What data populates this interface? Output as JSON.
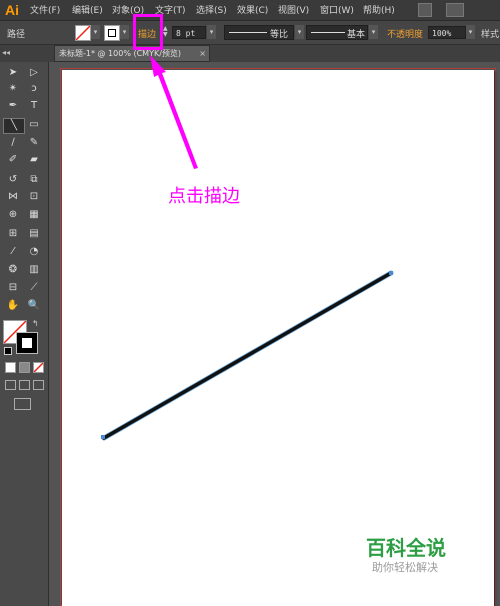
{
  "app": {
    "logo": "Ai"
  },
  "menus": [
    "文件(F)",
    "编辑(E)",
    "对象(O)",
    "文字(T)",
    "选择(S)",
    "效果(C)",
    "视图(V)",
    "窗口(W)",
    "帮助(H)"
  ],
  "control_bar": {
    "path_label": "路径",
    "stroke_label": "描边",
    "stroke_weight": "8 pt",
    "profile_label": "等比",
    "brush_label": "基本",
    "opacity_label": "不透明度",
    "opacity_value": "100%",
    "style_label": "样式"
  },
  "document_tab": {
    "title": "未标题-1* @ 100% (CMYK/预览)"
  },
  "annotation": {
    "text": "点击描边",
    "color": "#ff00ff"
  },
  "watermark": {
    "title": "百科全说",
    "subtitle": "助你轻松解决"
  },
  "icons": {
    "tools": [
      "selection-tool",
      "direct-selection-tool",
      "magic-wand-tool",
      "lasso-tool",
      "pen-tool",
      "type-tool",
      "line-segment-tool",
      "rectangle-tool",
      "paintbrush-tool",
      "pencil-tool",
      "blob-brush-tool",
      "eraser-tool",
      "rotate-tool",
      "scale-tool",
      "width-tool",
      "free-transform-tool",
      "shape-builder-tool",
      "perspective-grid-tool",
      "mesh-tool",
      "gradient-tool",
      "eyedropper-tool",
      "blend-tool",
      "symbol-sprayer-tool",
      "column-graph-tool",
      "artboard-tool",
      "slice-tool",
      "hand-tool",
      "zoom-tool"
    ]
  },
  "colors": {
    "accent": "#ff00ff",
    "stroke_line": "#111111",
    "watermark": "#2e9e45"
  }
}
